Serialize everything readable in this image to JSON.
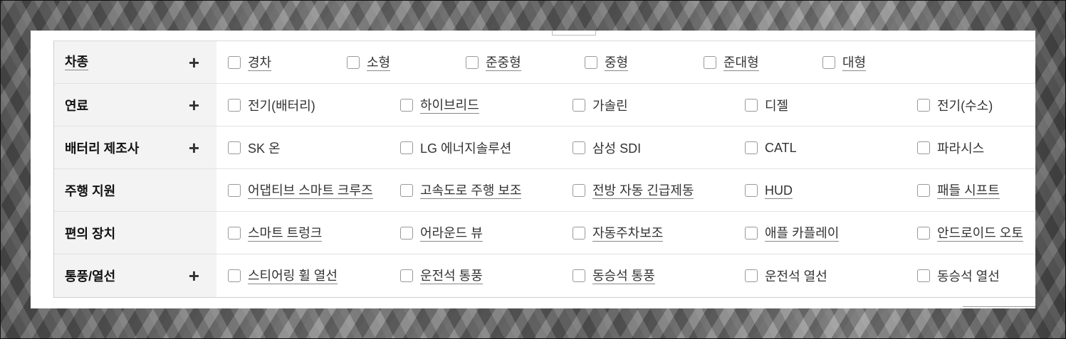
{
  "filter_rows": [
    {
      "key": "type",
      "label": "차종",
      "label_underlined": true,
      "expandable": true,
      "options": [
        {
          "label": "경차",
          "underlined": true
        },
        {
          "label": "소형",
          "underlined": true
        },
        {
          "label": "준중형",
          "underlined": true
        },
        {
          "label": "중형",
          "underlined": true
        },
        {
          "label": "준대형",
          "underlined": true
        },
        {
          "label": "대형",
          "underlined": true
        }
      ]
    },
    {
      "key": "fuel",
      "label": "연료",
      "label_underlined": false,
      "expandable": true,
      "options": [
        {
          "label": "전기(배터리)",
          "underlined": false
        },
        {
          "label": "하이브리드",
          "underlined": true
        },
        {
          "label": "가솔린",
          "underlined": false
        },
        {
          "label": "디젤",
          "underlined": false
        },
        {
          "label": "전기(수소)",
          "underlined": false
        }
      ]
    },
    {
      "key": "battery",
      "label": "배터리 제조사",
      "label_underlined": false,
      "expandable": true,
      "options": [
        {
          "label": "SK 온",
          "underlined": false
        },
        {
          "label": "LG 에너지솔루션",
          "underlined": false
        },
        {
          "label": "삼성 SDI",
          "underlined": false
        },
        {
          "label": "CATL",
          "underlined": false
        },
        {
          "label": "파라시스",
          "underlined": false
        }
      ]
    },
    {
      "key": "driving",
      "label": "주행 지원",
      "label_underlined": false,
      "expandable": false,
      "options": [
        {
          "label": "어댑티브 스마트 크루즈",
          "underlined": true
        },
        {
          "label": "고속도로 주행 보조",
          "underlined": true
        },
        {
          "label": "전방 자동 긴급제동",
          "underlined": true
        },
        {
          "label": "HUD",
          "underlined": true
        },
        {
          "label": "패들 시프트",
          "underlined": true
        }
      ]
    },
    {
      "key": "convenience",
      "label": "편의 장치",
      "label_underlined": false,
      "expandable": false,
      "options": [
        {
          "label": "스마트 트렁크",
          "underlined": true
        },
        {
          "label": "어라운드 뷰",
          "underlined": true
        },
        {
          "label": "자동주차보조",
          "underlined": true
        },
        {
          "label": "애플 카플레이",
          "underlined": true
        },
        {
          "label": "안드로이드 오토",
          "underlined": true
        }
      ]
    },
    {
      "key": "ventilation",
      "label": "통풍/열선",
      "label_underlined": false,
      "expandable": true,
      "options": [
        {
          "label": "스티어링 휠 열선",
          "underlined": true
        },
        {
          "label": "운전석 통풍",
          "underlined": true
        },
        {
          "label": "동승석 통풍",
          "underlined": true
        },
        {
          "label": "운전석 열선",
          "underlined": false
        },
        {
          "label": "동승석 열선",
          "underlined": false
        }
      ]
    }
  ]
}
